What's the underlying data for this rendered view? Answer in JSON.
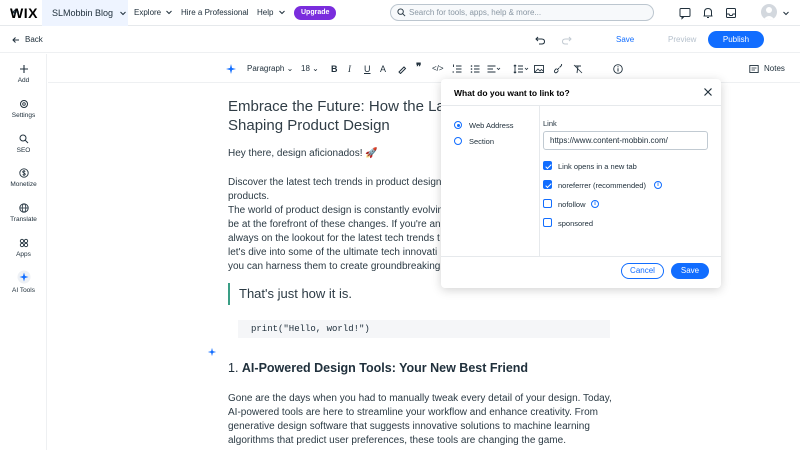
{
  "topbar": {
    "logo": "WIX",
    "site_name": "SLMobbin Blog",
    "nav": [
      "Explore",
      "Hire a Professional",
      "Help"
    ],
    "upgrade": "Upgrade",
    "search_placeholder": "Search for tools, apps, help & more..."
  },
  "editorbar": {
    "back": "Back",
    "save": "Save",
    "preview": "Preview",
    "publish": "Publish"
  },
  "toolbar": {
    "paragraph": "Paragraph",
    "font_size": "18",
    "notes": "Notes"
  },
  "sidebar": {
    "items": [
      {
        "label": "Add",
        "icon": "plus-icon"
      },
      {
        "label": "Settings",
        "icon": "gear-icon"
      },
      {
        "label": "SEO",
        "icon": "search-icon"
      },
      {
        "label": "Monetize",
        "icon": "dollar-icon"
      },
      {
        "label": "Translate",
        "icon": "globe-icon"
      },
      {
        "label": "Apps",
        "icon": "apps-icon"
      },
      {
        "label": "AI Tools",
        "icon": "sparkle-icon"
      }
    ]
  },
  "article": {
    "title_line1": "Embrace the Future: How the Late",
    "title_line2": "Shaping Product Design",
    "greeting": "Hey there, design aficionados! 🚀",
    "p1_l1": "Discover the latest tech trends in product design",
    "p1_l2": "products.",
    "p1_l3": "The world of product design is constantly evolvin",
    "p1_l4": "be at the forefront of these changes. If you're an",
    "p1_l5": "always on the lookout for the latest tech trends t",
    "p1_l6": "let's dive into some of the ultimate tech innovati",
    "p1_l7": "you can harness them to create groundbreaking",
    "quote": "That's just how it is.",
    "code": "print(\"Hello, world!\")",
    "h2_num": "1. ",
    "h2_text": "AI-Powered Design Tools: Your New Best Friend",
    "p2_l1": "Gone are the days when you had to manually tweak every detail of your design. Today,",
    "p2_l2": "AI-powered tools are here to streamline your workflow and enhance creativity. From",
    "p2_l3": "generative design software that suggests innovative solutions to machine learning",
    "p2_l4": "algorithms that predict user preferences, these tools are changing the game."
  },
  "link_dialog": {
    "title": "What do you want to link to?",
    "options": [
      "Web Address",
      "Section"
    ],
    "selected_option": "Web Address",
    "link_label": "Link",
    "link_value": "https://www.content-mobbin.com/",
    "checkboxes": [
      {
        "label": "Link opens in a new tab",
        "checked": true
      },
      {
        "label": "noreferrer (recommended)",
        "checked": true
      },
      {
        "label": "nofollow",
        "checked": false
      },
      {
        "label": "sponsored",
        "checked": false
      }
    ],
    "cancel": "Cancel",
    "save": "Save"
  },
  "colors": {
    "accent": "#116dff",
    "upgrade": "#7a2ddd",
    "quote_bar": "#3a9e85"
  }
}
